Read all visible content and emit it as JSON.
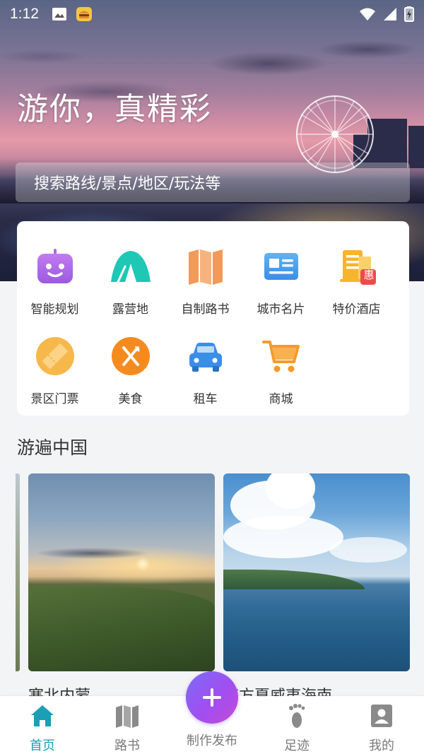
{
  "status_bar": {
    "time": "1:12",
    "left_icons": [
      "image-icon",
      "burger-app-icon"
    ],
    "right_icons": [
      "wifi-icon",
      "signal-icon",
      "battery-charging-icon"
    ]
  },
  "hero": {
    "title": "游你，真精彩",
    "search_placeholder": "搜索路线/景点/地区/玩法等"
  },
  "categories": [
    {
      "label": "智能规划",
      "icon": "robot-icon",
      "color": "#b066e6"
    },
    {
      "label": "露营地",
      "icon": "tent-icon",
      "color": "#1fc7b5"
    },
    {
      "label": "自制路书",
      "icon": "map-book-icon",
      "color": "#f29a57"
    },
    {
      "label": "城市名片",
      "icon": "id-card-icon",
      "color": "#3b98e8"
    },
    {
      "label": "特价酒店",
      "icon": "hotel-discount-icon",
      "color": "#f7b52b"
    },
    {
      "label": "景区门票",
      "icon": "ticket-icon",
      "color": "#f7b84b"
    },
    {
      "label": "美食",
      "icon": "fork-knife-icon",
      "color": "#f58b1f"
    },
    {
      "label": "租车",
      "icon": "car-icon",
      "color": "#3b8ee8"
    },
    {
      "label": "商城",
      "icon": "shopping-cart-icon",
      "color": "#f59a2b"
    }
  ],
  "hotel_badge": "惠",
  "section": {
    "title": "游遍中国",
    "cards": [
      {
        "caption": "塞北内蒙"
      },
      {
        "caption": "南方夏威夷海南"
      }
    ]
  },
  "bottom_nav": {
    "items": [
      {
        "label": "首页",
        "icon": "home-icon",
        "active": true
      },
      {
        "label": "路书",
        "icon": "map-book-icon",
        "active": false
      },
      {
        "label": "制作发布",
        "icon": "plus-icon",
        "active": false
      },
      {
        "label": "足迹",
        "icon": "footprint-icon",
        "active": false
      },
      {
        "label": "我的",
        "icon": "profile-icon",
        "active": false
      }
    ]
  },
  "colors": {
    "accent": "#1a9fb5",
    "publish_gradient_start": "#7b6cf6",
    "publish_gradient_end": "#c64ad8",
    "inactive_nav": "#7a7a7a"
  }
}
